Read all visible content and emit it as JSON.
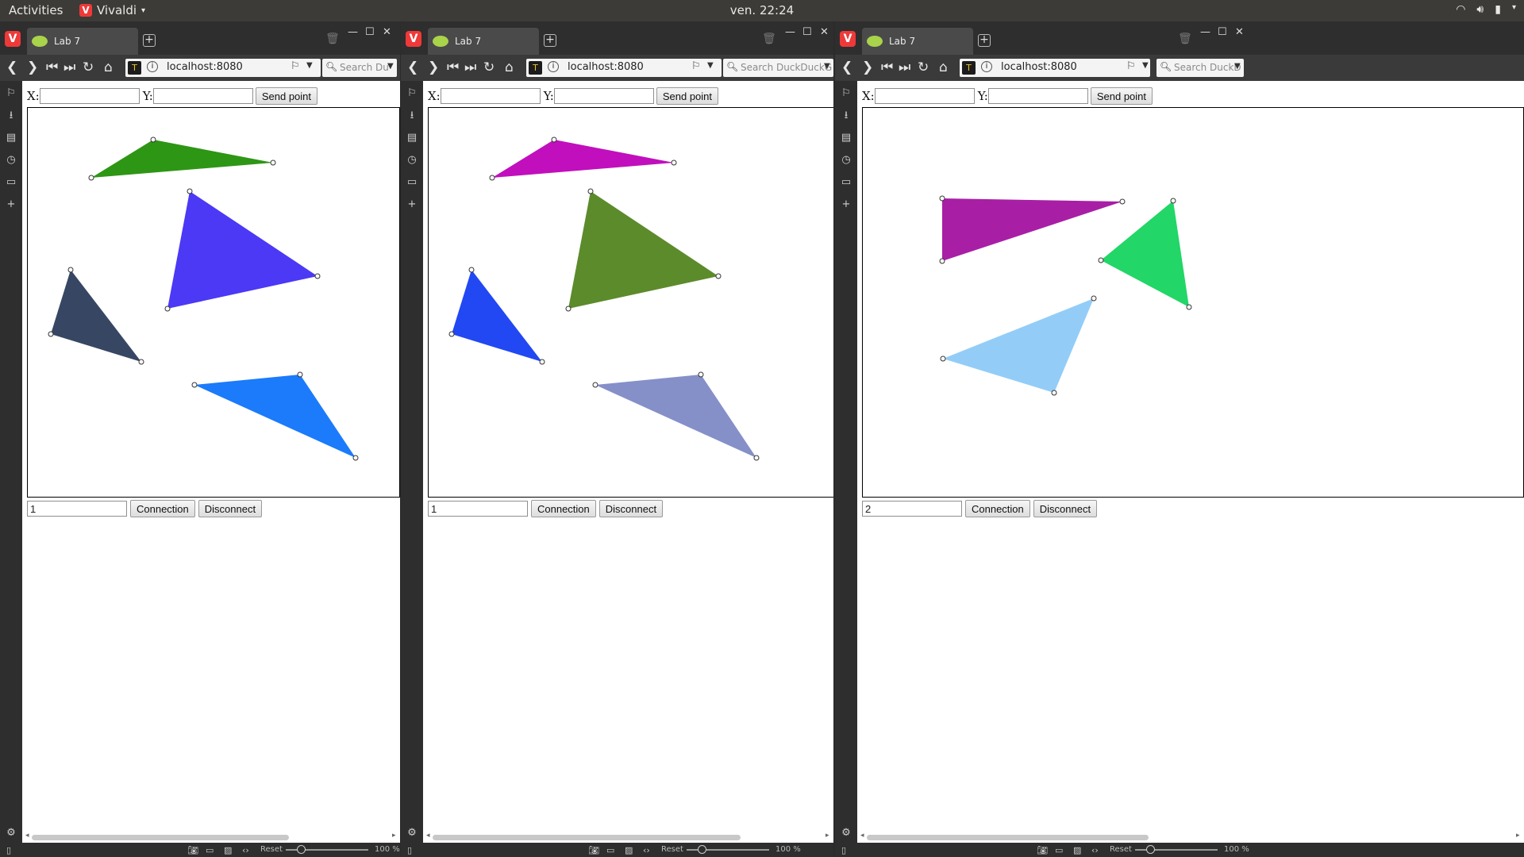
{
  "system": {
    "activities": "Activities",
    "app_name": "Vivaldi",
    "clock": "ven. 22:24"
  },
  "browser": {
    "tab_title": "Lab 7",
    "url": "localhost:8080",
    "status": {
      "reset": "Reset",
      "zoom": "100 %"
    }
  },
  "form": {
    "x_label": "X:",
    "y_label": "Y:",
    "send_label": "Send point",
    "connect_label": "Connection",
    "disconnect_label": "Disconnect"
  },
  "windows": [
    {
      "search_placeholder": "Search Du",
      "connection_id": "1",
      "triangles": [
        {
          "color": "#2e9615",
          "points": [
            [
              80,
              88
            ],
            [
              158,
              40
            ],
            [
              309,
              69
            ]
          ]
        },
        {
          "color": "#4b39f5",
          "points": [
            [
              204,
              105
            ],
            [
              365,
              212
            ],
            [
              176,
              253
            ]
          ]
        },
        {
          "color": "#374663",
          "points": [
            [
              54,
              204
            ],
            [
              143,
              320
            ],
            [
              29,
              285
            ]
          ]
        },
        {
          "color": "#1b7bfa",
          "points": [
            [
              210,
              349
            ],
            [
              343,
              336
            ],
            [
              413,
              441
            ]
          ]
        }
      ]
    },
    {
      "search_placeholder": "Search DuckDuckG",
      "connection_id": "1",
      "triangles": [
        {
          "color": "#c10fbd",
          "points": [
            [
              80,
              88
            ],
            [
              158,
              40
            ],
            [
              309,
              69
            ]
          ]
        },
        {
          "color": "#5c8b2b",
          "points": [
            [
              204,
              105
            ],
            [
              365,
              212
            ],
            [
              176,
              253
            ]
          ]
        },
        {
          "color": "#2148f2",
          "points": [
            [
              54,
              204
            ],
            [
              143,
              320
            ],
            [
              29,
              285
            ]
          ]
        },
        {
          "color": "#8590c9",
          "points": [
            [
              210,
              349
            ],
            [
              343,
              336
            ],
            [
              413,
              441
            ]
          ]
        }
      ]
    },
    {
      "search_placeholder": "Search DuckD",
      "connection_id": "2",
      "triangles": [
        {
          "color": "#a81fa5",
          "points": [
            [
              100,
              114
            ],
            [
              327,
              118
            ],
            [
              100,
              193
            ]
          ]
        },
        {
          "color": "#22d667",
          "points": [
            [
              391,
              117
            ],
            [
              411,
              251
            ],
            [
              300,
              192
            ]
          ]
        },
        {
          "color": "#93cdf7",
          "points": [
            [
              291,
              240
            ],
            [
              241,
              359
            ],
            [
              101,
              316
            ]
          ]
        }
      ]
    }
  ]
}
